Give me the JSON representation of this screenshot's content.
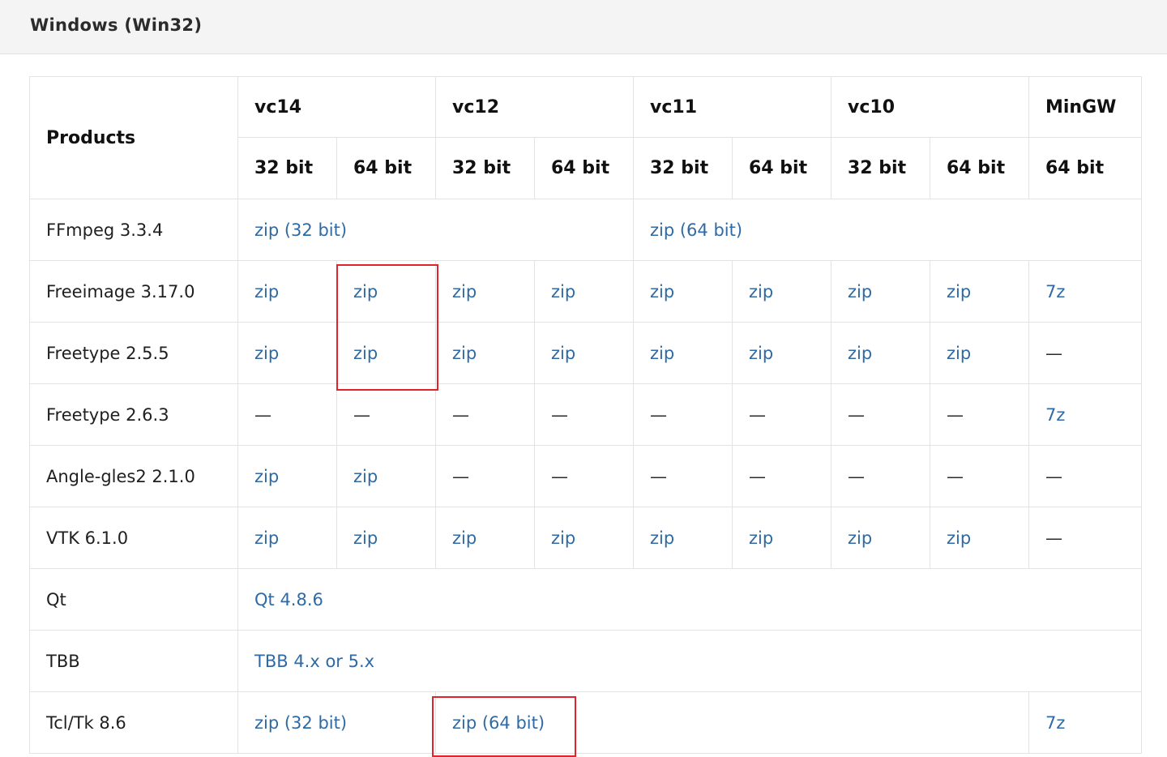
{
  "section": {
    "title": "Windows (Win32)"
  },
  "table": {
    "products_header": "Products",
    "groups": [
      "vc14",
      "vc12",
      "vc11",
      "vc10",
      "MinGW"
    ],
    "bits": [
      "32 bit",
      "64 bit",
      "32 bit",
      "64 bit",
      "32 bit",
      "64 bit",
      "32 bit",
      "64 bit",
      "64 bit"
    ],
    "rows": [
      {
        "product": "FFmpeg 3.3.4",
        "cells": [
          {
            "text": "zip (32 bit)",
            "link": true,
            "span": 4
          },
          {
            "text": "zip (64 bit)",
            "link": true,
            "span": 5
          }
        ]
      },
      {
        "product": "Freeimage 3.17.0",
        "cells": [
          {
            "text": "zip",
            "link": true
          },
          {
            "text": "zip",
            "link": true
          },
          {
            "text": "zip",
            "link": true
          },
          {
            "text": "zip",
            "link": true
          },
          {
            "text": "zip",
            "link": true
          },
          {
            "text": "zip",
            "link": true
          },
          {
            "text": "zip",
            "link": true
          },
          {
            "text": "zip",
            "link": true
          },
          {
            "text": "7z",
            "link": true
          }
        ]
      },
      {
        "product": "Freetype 2.5.5",
        "cells": [
          {
            "text": "zip",
            "link": true
          },
          {
            "text": "zip",
            "link": true
          },
          {
            "text": "zip",
            "link": true
          },
          {
            "text": "zip",
            "link": true
          },
          {
            "text": "zip",
            "link": true
          },
          {
            "text": "zip",
            "link": true
          },
          {
            "text": "zip",
            "link": true
          },
          {
            "text": "zip",
            "link": true
          },
          {
            "text": "—",
            "link": false
          }
        ]
      },
      {
        "product": "Freetype 2.6.3",
        "cells": [
          {
            "text": "—",
            "link": false
          },
          {
            "text": "—",
            "link": false
          },
          {
            "text": "—",
            "link": false
          },
          {
            "text": "—",
            "link": false
          },
          {
            "text": "—",
            "link": false
          },
          {
            "text": "—",
            "link": false
          },
          {
            "text": "—",
            "link": false
          },
          {
            "text": "—",
            "link": false
          },
          {
            "text": "7z",
            "link": true
          }
        ]
      },
      {
        "product": "Angle-gles2 2.1.0",
        "cells": [
          {
            "text": "zip",
            "link": true
          },
          {
            "text": "zip",
            "link": true
          },
          {
            "text": "—",
            "link": false
          },
          {
            "text": "—",
            "link": false
          },
          {
            "text": "—",
            "link": false
          },
          {
            "text": "—",
            "link": false
          },
          {
            "text": "—",
            "link": false
          },
          {
            "text": "—",
            "link": false
          },
          {
            "text": "—",
            "link": false
          }
        ]
      },
      {
        "product": "VTK 6.1.0",
        "cells": [
          {
            "text": "zip",
            "link": true
          },
          {
            "text": "zip",
            "link": true
          },
          {
            "text": "zip",
            "link": true
          },
          {
            "text": "zip",
            "link": true
          },
          {
            "text": "zip",
            "link": true
          },
          {
            "text": "zip",
            "link": true
          },
          {
            "text": "zip",
            "link": true
          },
          {
            "text": "zip",
            "link": true
          },
          {
            "text": "—",
            "link": false
          }
        ]
      },
      {
        "product": "Qt",
        "cells": [
          {
            "text": "Qt 4.8.6",
            "link": true,
            "span": 9
          }
        ]
      },
      {
        "product": "TBB",
        "cells": [
          {
            "text": "TBB 4.x or 5.x",
            "link": true,
            "span": 9
          }
        ]
      },
      {
        "product": "Tcl/Tk 8.6",
        "cells": [
          {
            "text": "zip (32 bit)",
            "link": true,
            "span": 2
          },
          {
            "text": "zip (64 bit)",
            "link": true,
            "span": 6
          },
          {
            "text": "7z",
            "link": true
          }
        ]
      }
    ]
  },
  "colors": {
    "link": "#2f6aa5",
    "highlight": "#e0242c",
    "header_bg": "#f4f4f4",
    "border": "#e3e3e3"
  }
}
